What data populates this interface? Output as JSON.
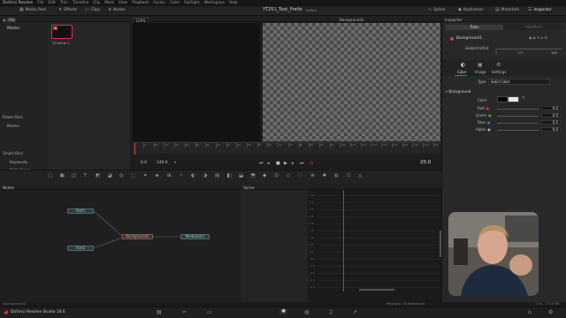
{
  "menubar": [
    "DaVinci Resolve",
    "File",
    "Edit",
    "Trim",
    "Timeline",
    "Clip",
    "Mark",
    "View",
    "Playback",
    "Fusion",
    "Color",
    "Fairlight",
    "Workspace",
    "Help"
  ],
  "toolbar": {
    "media_pool": "Media Pool",
    "effects": "Effects",
    "clips": "Clips",
    "nodes": "Nodes",
    "project_title": "YT251_Text_Prefix",
    "edited": "Edited",
    "spline": "Spline",
    "keyframes": "Keyframes",
    "metadata": "Metadata",
    "inspector": "Inspector"
  },
  "media_pool": {
    "bin_label": "Ma",
    "master": "Master",
    "thumb_label": "Timeline 1",
    "power_bins": "Power Bins",
    "power_master": "Master",
    "smart_bins": "Smart Bins",
    "keywords": "Keywords",
    "collections": "Collections"
  },
  "viewer": {
    "zoom": "129%",
    "title": "Background1",
    "time_left": "0.0",
    "time_end": "149.0",
    "timecode": "20.0",
    "ruler_labels": [
      "5",
      "10",
      "15",
      "20",
      "25",
      "30",
      "35",
      "40",
      "45",
      "50",
      "55",
      "60",
      "65",
      "70",
      "75",
      "80",
      "85",
      "90",
      "95",
      "100",
      "105",
      "110",
      "115",
      "120",
      "125",
      "130",
      "135",
      "140",
      "145"
    ]
  },
  "inspector": {
    "header": "Inspector",
    "tab_tools": "Tools",
    "tab_modifiers": "Modifiers",
    "node_name": "Background1",
    "global_inout": "Global In/Out",
    "global_in": "0",
    "global_mid": "150",
    "global_out": "149",
    "subtab_color": "Color",
    "subtab_image": "Image",
    "subtab_settings": "Settings",
    "type_label": "Type",
    "type_value": "Solid Color",
    "section": "Background",
    "color_label": "Color",
    "red_label": "Red",
    "red": "0.0",
    "green_label": "Green",
    "green": "0.0",
    "blue_label": "Blue",
    "blue": "0.0",
    "alpha_label": "Alpha",
    "alpha": "0.0"
  },
  "nodes": {
    "header": "Nodes",
    "text1": "Text1",
    "text2": "Text2",
    "background1": "Background1",
    "mediaout1": "MediaOut1"
  },
  "spline": {
    "header": "Spline",
    "axis": [
      "4.0",
      "3.5",
      "3.0",
      "2.5",
      "2.0",
      "1.5",
      "1.0",
      "0.5",
      "0.0",
      "-0.5",
      "-1.0",
      "-1.5",
      "-2.0",
      "-2.5"
    ]
  },
  "status": {
    "left": "(Background1)",
    "center": "Playback: 30 frames/sec",
    "right": "11% - 7713 MB",
    "app": "DaVinci Resolve Studio 18.6"
  },
  "colors": {
    "accent_red": "#e0343b",
    "playhead": "#d8403a",
    "node_text": "#4d6e6e",
    "node_bg": "#7a5a52"
  }
}
